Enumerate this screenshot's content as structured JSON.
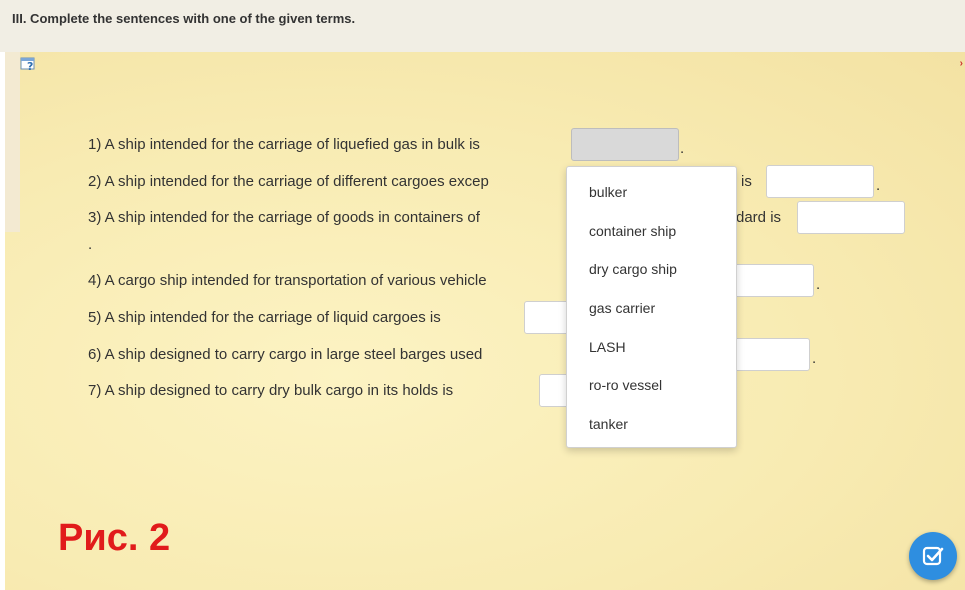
{
  "task": {
    "title": "III. Complete the sentences with one of the given terms."
  },
  "sentences": [
    {
      "text": "1) A ship intended for the carriage of liquefied gas in bulk is",
      "period": "."
    },
    {
      "text": "2) A ship intended for the carriage of different cargoes excep",
      "tail": "is",
      "period": "."
    },
    {
      "text": "3) A ship intended for the carriage of goods in containers of",
      "tail": "dard is",
      "period": "."
    },
    {
      "text": "4) A cargo ship intended for transportation of various vehicle",
      "period": "."
    },
    {
      "text": "5) A ship intended for the carriage of liquid cargoes is"
    },
    {
      "text": "6) A ship designed to carry cargo in large steel barges used",
      "period": "."
    },
    {
      "text": "7) A ship designed to carry dry bulk cargo in its holds is"
    }
  ],
  "dropdown": {
    "options": [
      "bulker",
      "container ship",
      "dry cargo ship",
      "gas carrier",
      "LASH",
      "ro-ro vessel",
      "tanker"
    ]
  },
  "overlay": {
    "figure_label": "Рис. 2"
  },
  "colors": {
    "paper": "#f8ebb2",
    "header": "#f1eee4",
    "label_red": "#e11b1b",
    "button_blue": "#2e8ee0"
  },
  "icons": {
    "help": "help-icon",
    "check": "check-icon"
  }
}
